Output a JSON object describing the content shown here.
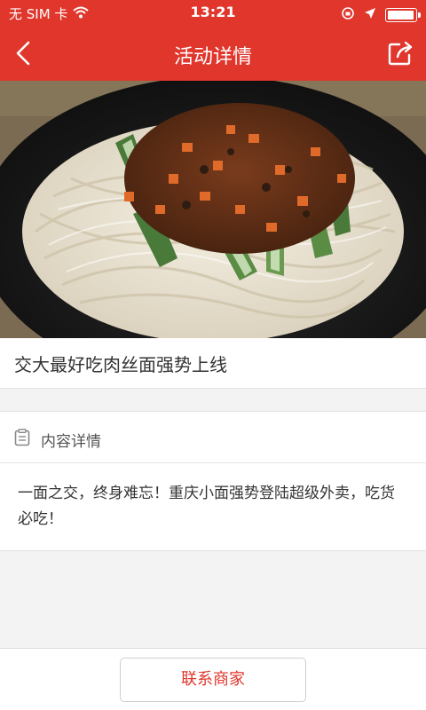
{
  "status_bar": {
    "carrier": "无 SIM 卡",
    "time": "13:21",
    "battery_level": 0.95
  },
  "nav": {
    "title": "活动详情",
    "back_icon": "chevron-left-icon",
    "share_icon": "share-icon"
  },
  "hero": {
    "description_icon": "noodle-dish-photo"
  },
  "activity": {
    "title": "交大最好吃肉丝面强势上线"
  },
  "content": {
    "header_label": "内容详情",
    "body": "一面之交，终身难忘！重庆小面强势登陆超级外卖，吃货必吃！"
  },
  "footer": {
    "contact_label": "联系商家"
  },
  "colors": {
    "primary": "#e0362c",
    "background": "#f3f3f3"
  }
}
